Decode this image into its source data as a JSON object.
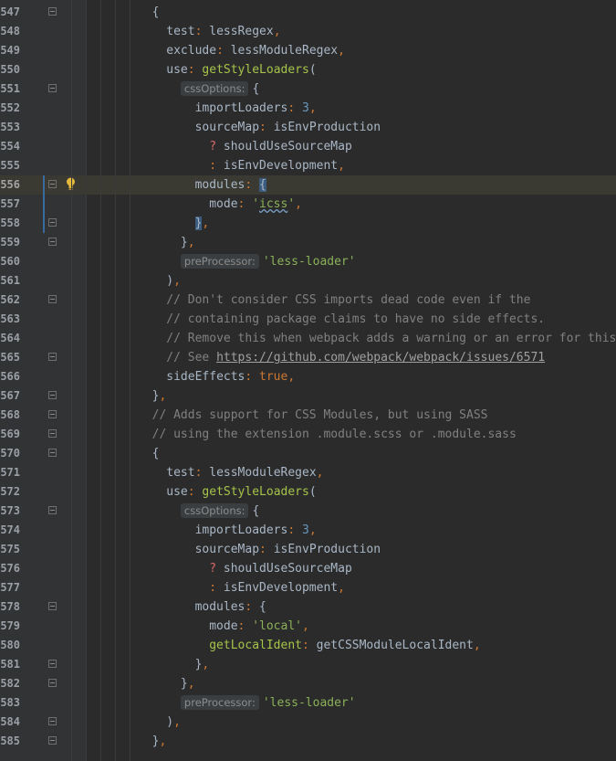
{
  "editor": {
    "lines": [
      {
        "num": "547",
        "indent": "        ",
        "parts": [
          {
            "t": "{",
            "c": ""
          }
        ]
      },
      {
        "num": "548",
        "indent": "          ",
        "parts": [
          {
            "t": "test",
            "c": ""
          },
          {
            "t": ": ",
            "c": "k"
          },
          {
            "t": "lessRegex",
            "c": ""
          },
          {
            "t": ",",
            "c": "k"
          }
        ]
      },
      {
        "num": "549",
        "indent": "          ",
        "parts": [
          {
            "t": "exclude",
            "c": ""
          },
          {
            "t": ": ",
            "c": "k"
          },
          {
            "t": "lessModuleRegex",
            "c": ""
          },
          {
            "t": ",",
            "c": "k"
          }
        ]
      },
      {
        "num": "550",
        "indent": "          ",
        "parts": [
          {
            "t": "use",
            "c": ""
          },
          {
            "t": ": ",
            "c": "k"
          },
          {
            "t": "getStyleLoaders",
            "c": "f"
          },
          {
            "t": "(",
            "c": ""
          }
        ]
      },
      {
        "num": "551",
        "indent": "            ",
        "parts": [
          {
            "t": "cssOptions:",
            "c": "hint"
          },
          {
            "t": "{",
            "c": ""
          }
        ]
      },
      {
        "num": "552",
        "indent": "              ",
        "parts": [
          {
            "t": "importLoaders",
            "c": ""
          },
          {
            "t": ": ",
            "c": "k"
          },
          {
            "t": "3",
            "c": "n"
          },
          {
            "t": ",",
            "c": "k"
          }
        ]
      },
      {
        "num": "553",
        "indent": "              ",
        "parts": [
          {
            "t": "sourceMap",
            "c": ""
          },
          {
            "t": ": ",
            "c": "k"
          },
          {
            "t": "isEnvProduction",
            "c": ""
          }
        ]
      },
      {
        "num": "554",
        "indent": "                ",
        "parts": [
          {
            "t": "? ",
            "c": "v"
          },
          {
            "t": "shouldUseSourceMap",
            "c": ""
          }
        ]
      },
      {
        "num": "555",
        "indent": "                ",
        "parts": [
          {
            "t": ": ",
            "c": "k"
          },
          {
            "t": "isEnvDevelopment",
            "c": ""
          },
          {
            "t": ",",
            "c": "k"
          }
        ]
      },
      {
        "num": "556",
        "indent": "              ",
        "current": true,
        "parts": [
          {
            "t": "modules",
            "c": ""
          },
          {
            "t": ": ",
            "c": "k"
          },
          {
            "t": "{",
            "c": "match"
          }
        ]
      },
      {
        "num": "557",
        "indent": "                ",
        "parts": [
          {
            "t": "mode",
            "c": ""
          },
          {
            "t": ": ",
            "c": "k"
          },
          {
            "t": "'",
            "c": "s"
          },
          {
            "t": "icss",
            "c": "s squig"
          },
          {
            "t": "'",
            "c": "s"
          },
          {
            "t": ",",
            "c": "k"
          }
        ]
      },
      {
        "num": "558",
        "indent": "              ",
        "parts": [
          {
            "t": "}",
            "c": "match"
          },
          {
            "t": ",",
            "c": "k"
          }
        ]
      },
      {
        "num": "559",
        "indent": "            ",
        "parts": [
          {
            "t": "}",
            "c": ""
          },
          {
            "t": ",",
            "c": "k"
          }
        ]
      },
      {
        "num": "560",
        "indent": "            ",
        "parts": [
          {
            "t": "preProcessor:",
            "c": "hint"
          },
          {
            "t": "'less-loader'",
            "c": "s"
          }
        ]
      },
      {
        "num": "561",
        "indent": "          ",
        "parts": [
          {
            "t": ")",
            "c": ""
          },
          {
            "t": ",",
            "c": "k"
          }
        ]
      },
      {
        "num": "562",
        "indent": "          ",
        "parts": [
          {
            "t": "// Don't consider CSS imports dead code even if the",
            "c": "c"
          }
        ]
      },
      {
        "num": "563",
        "indent": "          ",
        "parts": [
          {
            "t": "// containing package claims to have no side effects.",
            "c": "c"
          }
        ]
      },
      {
        "num": "564",
        "indent": "          ",
        "parts": [
          {
            "t": "// Remove this when webpack adds a warning or an error for this.",
            "c": "c"
          }
        ]
      },
      {
        "num": "565",
        "indent": "          ",
        "parts": [
          {
            "t": "// See ",
            "c": "c"
          },
          {
            "t": "https://github.com/webpack/webpack/issues/6571",
            "c": "link"
          }
        ]
      },
      {
        "num": "566",
        "indent": "          ",
        "parts": [
          {
            "t": "sideEffects",
            "c": ""
          },
          {
            "t": ": ",
            "c": "k"
          },
          {
            "t": "true",
            "c": "k"
          },
          {
            "t": ",",
            "c": "k"
          }
        ]
      },
      {
        "num": "567",
        "indent": "        ",
        "parts": [
          {
            "t": "}",
            "c": ""
          },
          {
            "t": ",",
            "c": "k"
          }
        ]
      },
      {
        "num": "568",
        "indent": "        ",
        "parts": [
          {
            "t": "// Adds support for CSS Modules, but using SASS",
            "c": "c"
          }
        ]
      },
      {
        "num": "569",
        "indent": "        ",
        "parts": [
          {
            "t": "// using the extension .module.scss or .module.sass",
            "c": "c"
          }
        ]
      },
      {
        "num": "570",
        "indent": "        ",
        "parts": [
          {
            "t": "{",
            "c": ""
          }
        ]
      },
      {
        "num": "571",
        "indent": "          ",
        "parts": [
          {
            "t": "test",
            "c": ""
          },
          {
            "t": ": ",
            "c": "k"
          },
          {
            "t": "lessModuleRegex",
            "c": ""
          },
          {
            "t": ",",
            "c": "k"
          }
        ]
      },
      {
        "num": "572",
        "indent": "          ",
        "parts": [
          {
            "t": "use",
            "c": ""
          },
          {
            "t": ": ",
            "c": "k"
          },
          {
            "t": "getStyleLoaders",
            "c": "f"
          },
          {
            "t": "(",
            "c": ""
          }
        ]
      },
      {
        "num": "573",
        "indent": "            ",
        "parts": [
          {
            "t": "cssOptions:",
            "c": "hint"
          },
          {
            "t": "{",
            "c": ""
          }
        ]
      },
      {
        "num": "574",
        "indent": "              ",
        "parts": [
          {
            "t": "importLoaders",
            "c": ""
          },
          {
            "t": ": ",
            "c": "k"
          },
          {
            "t": "3",
            "c": "n"
          },
          {
            "t": ",",
            "c": "k"
          }
        ]
      },
      {
        "num": "575",
        "indent": "              ",
        "parts": [
          {
            "t": "sourceMap",
            "c": ""
          },
          {
            "t": ": ",
            "c": "k"
          },
          {
            "t": "isEnvProduction",
            "c": ""
          }
        ]
      },
      {
        "num": "576",
        "indent": "                ",
        "parts": [
          {
            "t": "? ",
            "c": "v"
          },
          {
            "t": "shouldUseSourceMap",
            "c": ""
          }
        ]
      },
      {
        "num": "577",
        "indent": "                ",
        "parts": [
          {
            "t": ": ",
            "c": "k"
          },
          {
            "t": "isEnvDevelopment",
            "c": ""
          },
          {
            "t": ",",
            "c": "k"
          }
        ]
      },
      {
        "num": "578",
        "indent": "              ",
        "parts": [
          {
            "t": "modules",
            "c": ""
          },
          {
            "t": ": ",
            "c": "k"
          },
          {
            "t": "{",
            "c": ""
          }
        ]
      },
      {
        "num": "579",
        "indent": "                ",
        "parts": [
          {
            "t": "mode",
            "c": ""
          },
          {
            "t": ": ",
            "c": "k"
          },
          {
            "t": "'local'",
            "c": "s"
          },
          {
            "t": ",",
            "c": "k"
          }
        ]
      },
      {
        "num": "580",
        "indent": "                ",
        "parts": [
          {
            "t": "getLocalIdent",
            "c": "f"
          },
          {
            "t": ": ",
            "c": "k"
          },
          {
            "t": "getCSSModuleLocalIdent",
            "c": ""
          },
          {
            "t": ",",
            "c": "k"
          }
        ]
      },
      {
        "num": "581",
        "indent": "              ",
        "parts": [
          {
            "t": "}",
            "c": ""
          },
          {
            "t": ",",
            "c": "k"
          }
        ]
      },
      {
        "num": "582",
        "indent": "            ",
        "parts": [
          {
            "t": "}",
            "c": ""
          },
          {
            "t": ",",
            "c": "k"
          }
        ]
      },
      {
        "num": "583",
        "indent": "            ",
        "parts": [
          {
            "t": "preProcessor:",
            "c": "hint"
          },
          {
            "t": "'less-loader'",
            "c": "s"
          }
        ]
      },
      {
        "num": "584",
        "indent": "          ",
        "parts": [
          {
            "t": ")",
            "c": ""
          },
          {
            "t": ",",
            "c": "k"
          }
        ]
      },
      {
        "num": "585",
        "indent": "        ",
        "parts": [
          {
            "t": "}",
            "c": ""
          },
          {
            "t": ",",
            "c": "k"
          }
        ]
      }
    ]
  },
  "colors": {
    "background": "#2b2b2b",
    "gutter": "#313335",
    "keyword": "#cc7832",
    "function": "#a6c44a",
    "string": "#8bb158",
    "number": "#6897bb",
    "comment": "#808080"
  },
  "icons": {
    "intention": "lightbulb-icon",
    "fold": "fold-marker-icon"
  }
}
